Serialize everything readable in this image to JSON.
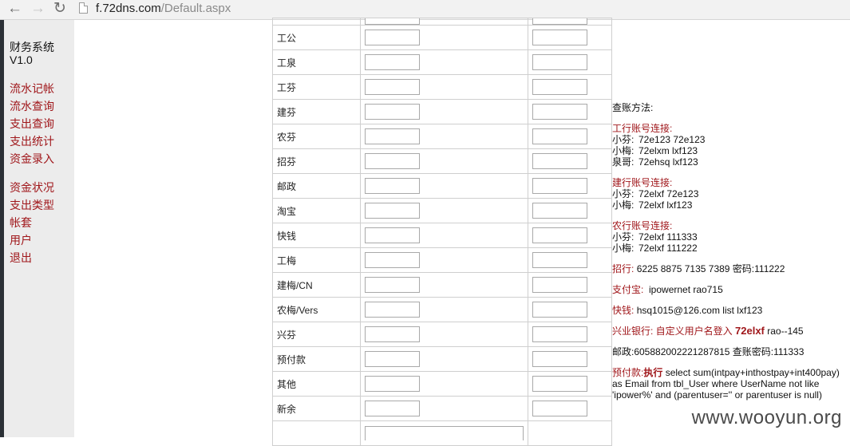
{
  "browser": {
    "url_host": "f.72dns.com",
    "url_path": "/Default.aspx"
  },
  "sidebar": {
    "title_line1": "财务系统",
    "title_line2": "V1.0",
    "menu_group1": [
      "流水记帐",
      "流水查询",
      "支出查询",
      "支出统计",
      "资金录入"
    ],
    "menu_group2": [
      "资金状况",
      "支出类型",
      "帐套",
      "用户",
      "退出"
    ]
  },
  "form": {
    "rows": [
      "工公",
      "工泉",
      "工芬",
      "建芬",
      "农芬",
      "招芬",
      "邮政",
      "淘宝",
      "快钱",
      "工梅",
      "建梅/CN",
      "农梅/Vers",
      "兴芬",
      "预付款",
      "其他",
      "新余"
    ]
  },
  "info": {
    "title": "查账方法:",
    "icbc_header": "工行账号连接:",
    "icbc": [
      {
        "name": "小芬:",
        "value": "72e123 72e123"
      },
      {
        "name": "小梅:",
        "value": "72elxm lxf123"
      },
      {
        "name": "泉哥:",
        "value": "72ehsq lxf123"
      }
    ],
    "ccb_header": "建行账号连接:",
    "ccb": [
      {
        "name": "小芬:",
        "value": "72elxf 72e123"
      },
      {
        "name": "小梅:",
        "value": "72elxf lxf123"
      }
    ],
    "abc_header": "农行账号连接:",
    "abc": [
      {
        "name": "小芬:",
        "value": "72elxf 111333"
      },
      {
        "name": "小梅:",
        "value": "72elxf 111222"
      }
    ],
    "cmb_label": "招行:",
    "cmb_value": "6225 8875 7135 7389 密码:111222",
    "alipay_label": "支付宝:",
    "alipay_value": "ipowernet rao715",
    "kuaiqian_label": "快钱:",
    "kuaiqian_value": "hsq1015@126.com list lxf123",
    "cib_label": "兴业银行: 自定义用户名登入",
    "cib_user": "72elxf",
    "cib_pass": "rao--145",
    "post_value": "邮政:605882002221287815 查账密码:111333",
    "prepay_label": "预付款:",
    "prepay_exec": "执行",
    "prepay_sql": "select sum(intpay+inthostpay+int400pay) as Email from tbl_User where UserName not like 'ipower%' and (parentuser='' or parentuser is null)"
  },
  "watermark": "www.wooyun.org"
}
